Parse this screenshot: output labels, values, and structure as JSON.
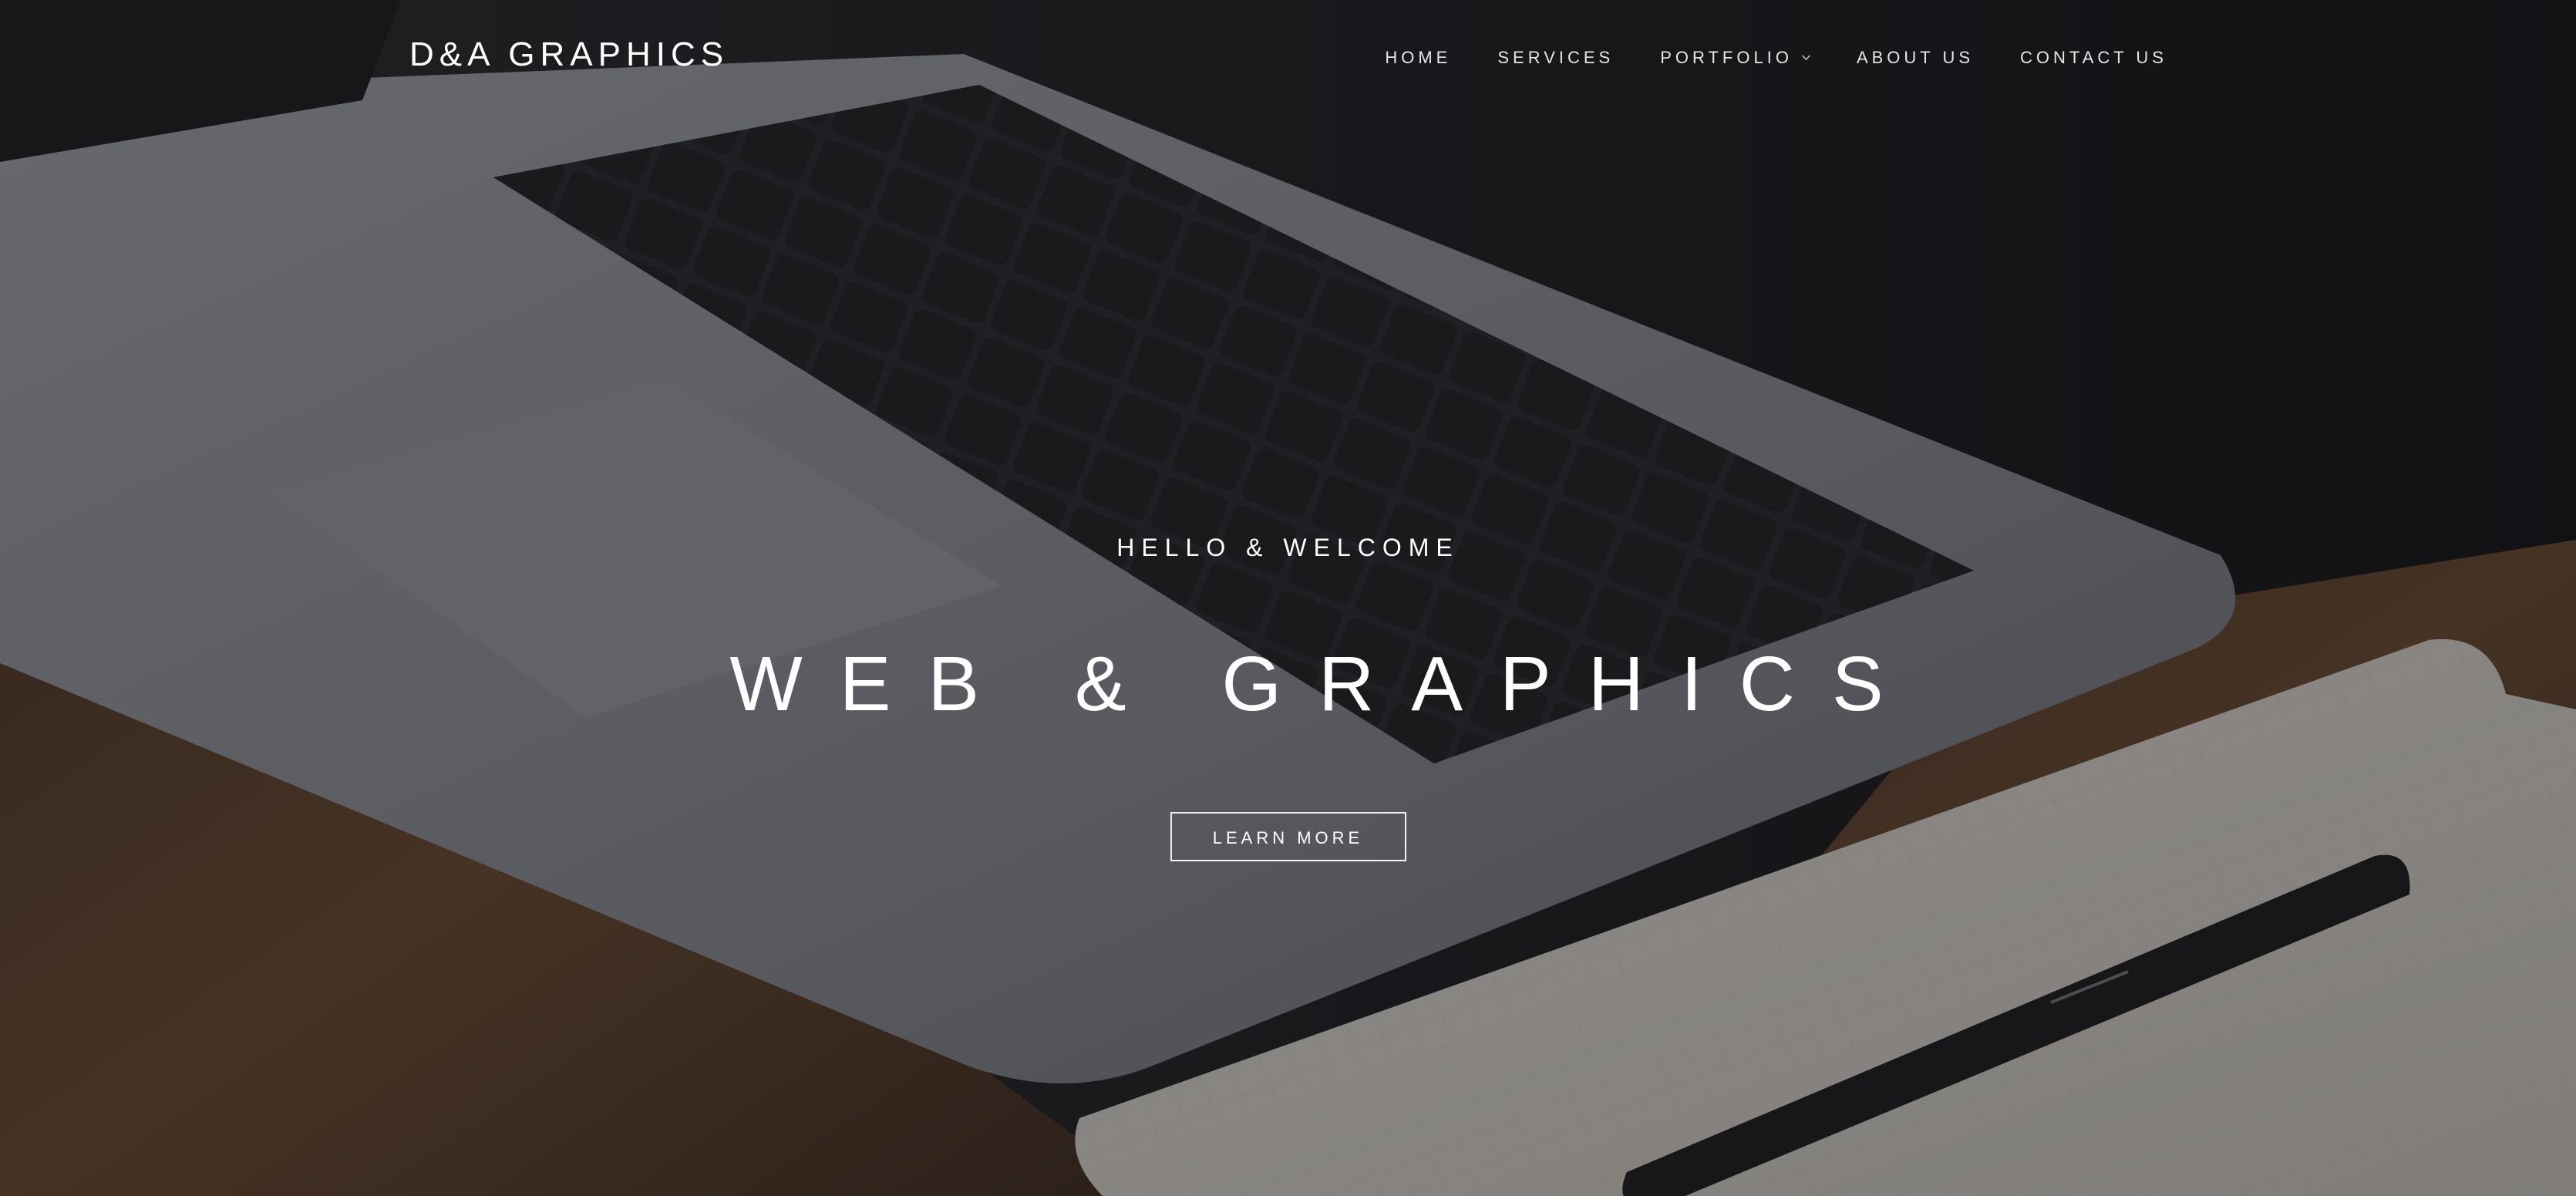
{
  "brand": {
    "logo_text": "D&A GRAPHICS"
  },
  "nav": {
    "items": [
      {
        "label": "HOME"
      },
      {
        "label": "SERVICES"
      },
      {
        "label": "PORTFOLIO",
        "has_dropdown": true
      },
      {
        "label": "ABOUT US"
      },
      {
        "label": "CONTACT US"
      }
    ]
  },
  "hero": {
    "eyebrow": "HELLO & WELCOME",
    "title": "WEB & GRAPHICS",
    "cta_label": "LEARN MORE",
    "background": "laptop-keyboard-notebook-pen-photo"
  },
  "colors": {
    "text": "#ffffff",
    "overlay": "#141418",
    "desk": "#6b4a2e",
    "laptop": "#8c8e94"
  }
}
